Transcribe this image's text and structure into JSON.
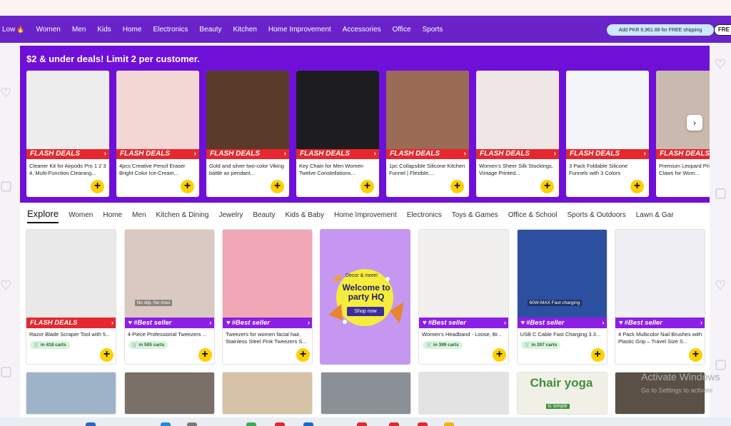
{
  "nav": {
    "items": [
      "Low",
      "Women",
      "Men",
      "Kids",
      "Home",
      "Electronics",
      "Beauty",
      "Kitchen",
      "Home Improvement",
      "Accessories",
      "Office",
      "Sports"
    ],
    "shipping_text": "Add PKR 6,961.88 for FREE shipping",
    "free_label": "FRE"
  },
  "deals": {
    "title": "$2 & under deals! Limit 2 per customer.",
    "badge": "FLASH DEALS",
    "items": [
      {
        "title": "Cleaner Kit for Airpods Pro 1 2 3 4, Multi-Function Cleaning...",
        "img_color": "#ededed"
      },
      {
        "title": "4pcs Creative Pencil Eraser Bright Color Ice-Cream...",
        "img_color": "#f3d7d5"
      },
      {
        "title": "Gold and silver two-color Viking battle ax pendant...",
        "img_color": "#5a3b2a"
      },
      {
        "title": "Key Chain for Men Women Twelve Constellations...",
        "img_color": "#1d1d1f"
      },
      {
        "title": "1pc Collapsible Silicone Kitchen Funnel | Flexible,...",
        "img_color": "#9a6b55"
      },
      {
        "title": "Women's Sheer Silk Stockings, Vintage Printed...",
        "img_color": "#efe7e5"
      },
      {
        "title": "3 Pack Foldable Silicone Funnels with 3 Colors",
        "img_color": "#f3f5f6"
      },
      {
        "title": "Premium Leopard Print Hair Claws for Wom...",
        "img_color": "#c9b9ae"
      }
    ]
  },
  "explore": {
    "label": "Explore",
    "tabs": [
      "Women",
      "Home",
      "Men",
      "Kitchen & Dining",
      "Jewelry",
      "Beauty",
      "Kids & Baby",
      "Home Improvement",
      "Electronics",
      "Toys & Games",
      "Office & School",
      "Sports & Outdoors",
      "Lawn & Gar"
    ]
  },
  "products": [
    {
      "tag": "FLASH DEALS",
      "title": "Razor Blade Scraper Tool with 5...",
      "carts": "in 418 carts",
      "img_color": "#e9e9ea"
    },
    {
      "tag": "#Best seller",
      "title": "4-Piece Professional Tweezers ...",
      "carts": "in 505 carts",
      "img_color": "#d9c9c2",
      "overlay": "No slip, No miss"
    },
    {
      "tag": "#Best seller",
      "title": "Tweezers for women facial hair, Stainless Steel Pink Tweezers S...",
      "carts": "",
      "img_color": "#f2a7b7"
    },
    {
      "tag": "#Best seller",
      "title": "Women's Headband - Loose, Br...",
      "carts": "in 399 carts",
      "img_color": "#f2f0ef"
    },
    {
      "tag": "#Best seller",
      "title": "USB C Cable Fast Charging 3.3...",
      "carts": "in 207 carts",
      "img_color": "#2d4fa0",
      "overlay": "60W-MAX Fast charging"
    },
    {
      "tag": "#Best seller",
      "title": "4 Pack Multicolor Nail Brushes with Plastic Grip – Travel Size S...",
      "carts": "",
      "img_color": "#efeff4"
    }
  ],
  "promo": {
    "small": "Decor & more!",
    "big": "Welcome to party HQ",
    "button": "Shop now"
  },
  "thumbs": [
    "#9fb3c8",
    "#7a7068",
    "#d6c2a6",
    "#8b8f96",
    "#e3e3e3",
    "#f0f0e6",
    "#5b5046"
  ],
  "thumb_overlay": {
    "chair_yoga": "Chair yoga",
    "is_simple": "is simple"
  },
  "watermark": {
    "title": "Activate Windows",
    "sub": "Go to Settings to activate"
  }
}
